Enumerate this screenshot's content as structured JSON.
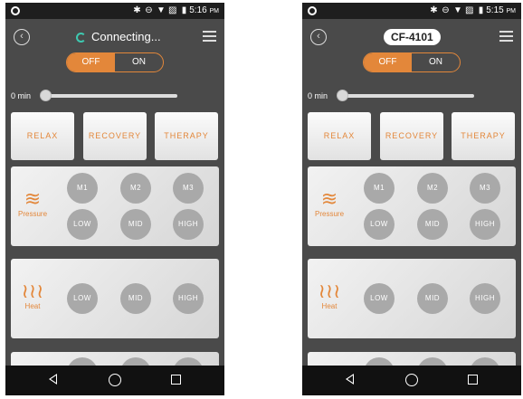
{
  "colors": {
    "accent": "#e3873a",
    "background": "#4a4a4a",
    "button_gray": "#a9a9a9"
  },
  "status_bar": {
    "icons": [
      "bluetooth-icon",
      "dnd-icon",
      "wifi-icon",
      "no-sim-icon",
      "battery-icon"
    ],
    "left": {
      "time": "5:16",
      "ampm": "PM"
    },
    "right": {
      "time": "5:15",
      "ampm": "PM"
    }
  },
  "left": {
    "title": "Connecting..."
  },
  "right": {
    "title": "CF-4101"
  },
  "power_toggle": {
    "off_label": "OFF",
    "on_label": "ON",
    "selected": "OFF"
  },
  "timer": {
    "label": "0 min",
    "value_min": 0
  },
  "modes": [
    {
      "label": "RELAX"
    },
    {
      "label": "RECOVERY"
    },
    {
      "label": "THERAPY"
    }
  ],
  "pressure": {
    "label": "Pressure",
    "buttons": [
      "M1",
      "M2",
      "M3",
      "LOW",
      "MID",
      "HIGH"
    ]
  },
  "heat": {
    "label": "Heat",
    "buttons": [
      "LOW",
      "MID",
      "HIGH"
    ]
  },
  "navbar": {
    "icons": [
      "back-icon",
      "home-icon",
      "recent-apps-icon"
    ]
  }
}
